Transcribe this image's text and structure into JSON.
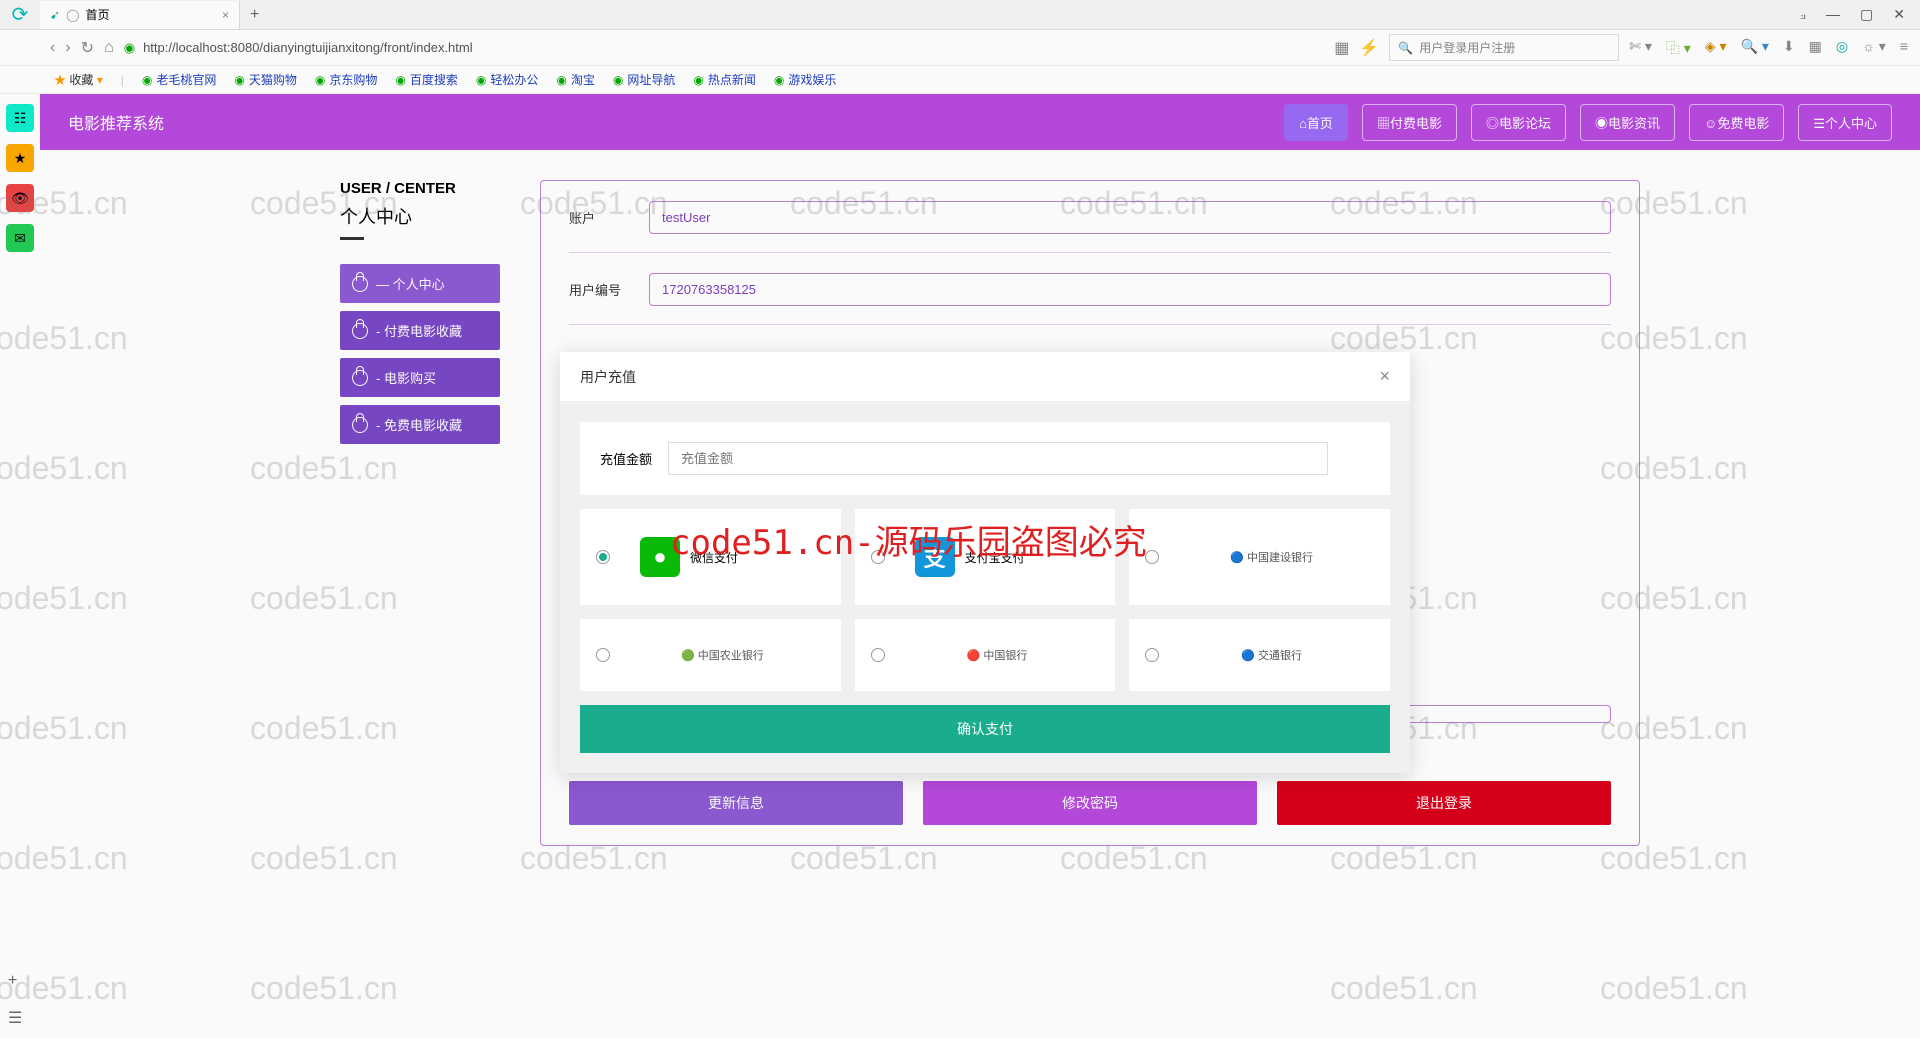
{
  "browser": {
    "tab_title": "首页",
    "tab_add": "+",
    "url": "http://localhost:8080/dianyingtuijianxitong/front/index.html",
    "search_placeholder": "用户登录用户注册"
  },
  "bookmarks": {
    "fav": "收藏",
    "items": [
      "老毛桃官网",
      "天猫购物",
      "京东购物",
      "百度搜索",
      "轻松办公",
      "淘宝",
      "网址导航",
      "热点新闻",
      "游戏娱乐"
    ]
  },
  "site": {
    "title": "电影推荐系统",
    "nav": [
      {
        "label": "首页",
        "icon": "⌂"
      },
      {
        "label": "付费电影",
        "icon": "▦"
      },
      {
        "label": "电影论坛",
        "icon": "◎"
      },
      {
        "label": "电影资讯",
        "icon": "◉"
      },
      {
        "label": "免费电影",
        "icon": "☺"
      },
      {
        "label": "个人中心",
        "icon": "☰"
      }
    ]
  },
  "user_center": {
    "title_en": "USER / CENTER",
    "title_cn": "个人中心",
    "menu": [
      {
        "label": "— 个人中心"
      },
      {
        "label": "- 付费电影收藏"
      },
      {
        "label": "- 电影购买"
      },
      {
        "label": "- 免费电影收藏"
      }
    ]
  },
  "form": {
    "account_label": "账户",
    "account_value": "testUser",
    "userid_label": "用户编号",
    "userid_value": "1720763358125"
  },
  "actions": {
    "update": "更新信息",
    "pwd": "修改密码",
    "logout": "退出登录"
  },
  "modal": {
    "title": "用户充值",
    "amount_label": "充值金额",
    "amount_placeholder": "充值金额",
    "options": [
      {
        "label": "微信支付",
        "logo_bg": "#09bb07",
        "logo_text": "●"
      },
      {
        "label": "支付宝支付",
        "logo_bg": "#1296db",
        "logo_text": "支"
      },
      {
        "label": "中国建设银行",
        "bank": true
      },
      {
        "label": "中国农业银行",
        "bank": true
      },
      {
        "label": "中国银行",
        "bank": true
      },
      {
        "label": "交通银行",
        "bank": true
      }
    ],
    "confirm": "确认支付"
  },
  "watermark": "code51.cn",
  "watermark_red": "code51.cn-源码乐园盗图必究"
}
